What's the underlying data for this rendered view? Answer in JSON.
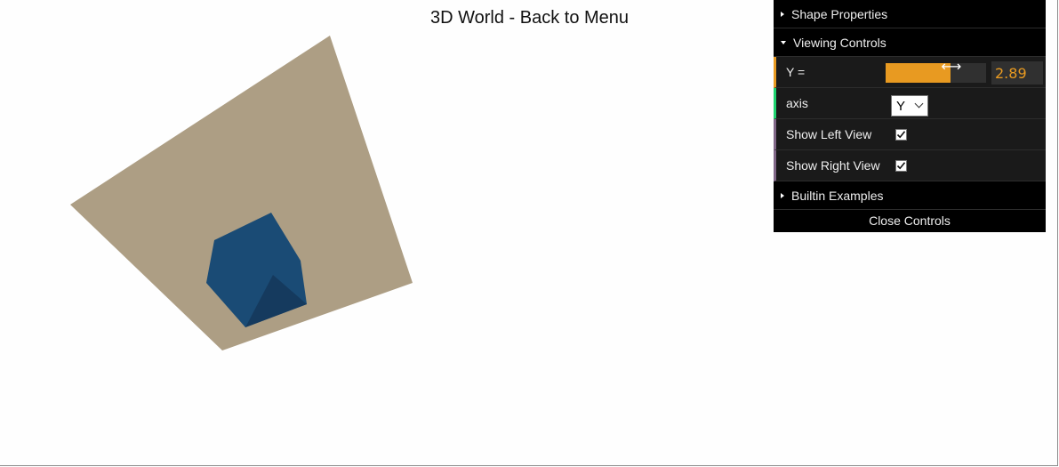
{
  "page": {
    "title": "3D World - Back to Menu"
  },
  "scene": {
    "objects": [
      "plane",
      "cube"
    ],
    "colors": {
      "plane": "#ad9e84",
      "cube_light": "#1a4b75",
      "cube_dark": "#153a5e"
    }
  },
  "gui": {
    "folders": {
      "shape_properties": {
        "label": "Shape Properties",
        "collapsed": true
      },
      "viewing_controls": {
        "label": "Viewing Controls",
        "collapsed": false
      },
      "builtin_examples": {
        "label": "Builtin Examples",
        "collapsed": true
      }
    },
    "controls": {
      "y": {
        "label": "Y =",
        "value": "2.89",
        "slider_fraction": 0.65
      },
      "axis": {
        "label": "axis",
        "selected": "Y"
      },
      "show_left_view": {
        "label": "Show Left View",
        "checked": true
      },
      "show_right_view": {
        "label": "Show Right View",
        "checked": true
      }
    },
    "close_label": "Close Controls",
    "colors": {
      "number_accent": "#e89a21",
      "option_accent": "#1ed36f",
      "bool_accent": "#806787"
    }
  }
}
